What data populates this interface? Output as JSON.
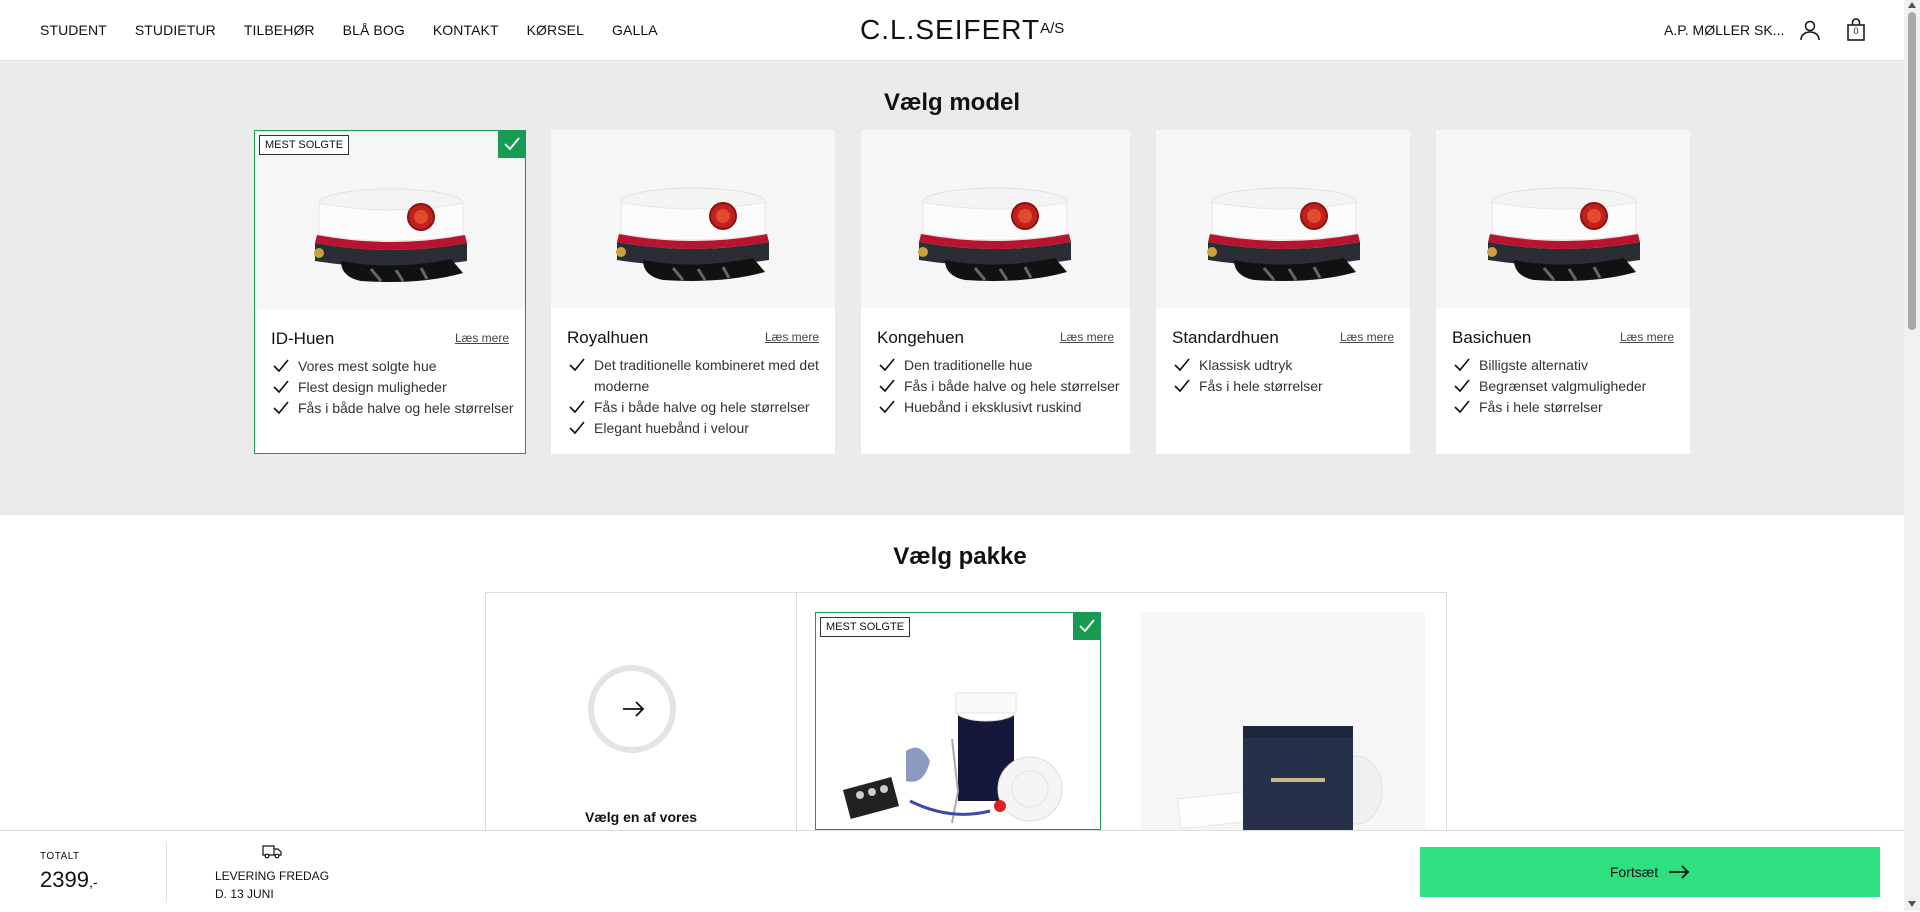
{
  "nav": [
    "STUDENT",
    "STUDIETUR",
    "TILBEHØR",
    "BLÅ BOG",
    "KONTAKT",
    "KØRSEL",
    "GALLA"
  ],
  "logo": {
    "text": "C.L.SEIFERT",
    "suffix": "A/S"
  },
  "header": {
    "school": "A.P. MØLLER SK...",
    "cart_count": "0"
  },
  "model_section": {
    "title": "Vælg model",
    "cards": [
      {
        "name": "ID-Huen",
        "read_more": "Læs mere",
        "badge": "MEST SOLGTE",
        "selected": true,
        "features": [
          "Vores mest solgte hue",
          "Flest design muligheder",
          "Fås i både halve og hele størrelser"
        ]
      },
      {
        "name": "Royalhuen",
        "read_more": "Læs mere",
        "features": [
          "Det traditionelle kombineret med det moderne",
          "Fås i både halve og hele størrelser",
          "Elegant huebånd i velour"
        ]
      },
      {
        "name": "Kongehuen",
        "read_more": "Læs mere",
        "features": [
          "Den traditionelle hue",
          "Fås i både halve og hele størrelser",
          "Huebånd i eksklusivt ruskind"
        ]
      },
      {
        "name": "Standardhuen",
        "read_more": "Læs mere",
        "features": [
          "Klassisk udtryk",
          "Fås i hele størrelser"
        ]
      },
      {
        "name": "Basichuen",
        "read_more": "Læs mere",
        "features": [
          "Billigste alternativ",
          "Begrænset valgmuligheder",
          "Fås i hele størrelser"
        ]
      }
    ]
  },
  "package_section": {
    "title": "Vælg pakke",
    "choose_text": "Vælg en af vores",
    "badge": "MEST SOLGTE",
    "selected_index": 1
  },
  "bottom": {
    "total_label": "TOTALT",
    "total_value": "2399",
    "total_suffix": ",-",
    "delivery_line1": "LEVERING FREDAG",
    "delivery_line2": "D. 13 JUNI",
    "continue_label": "Fortsæt"
  },
  "colors": {
    "accent_green": "#179b52",
    "cta": "#2ee07f",
    "section_bg": "#ebebeb"
  }
}
